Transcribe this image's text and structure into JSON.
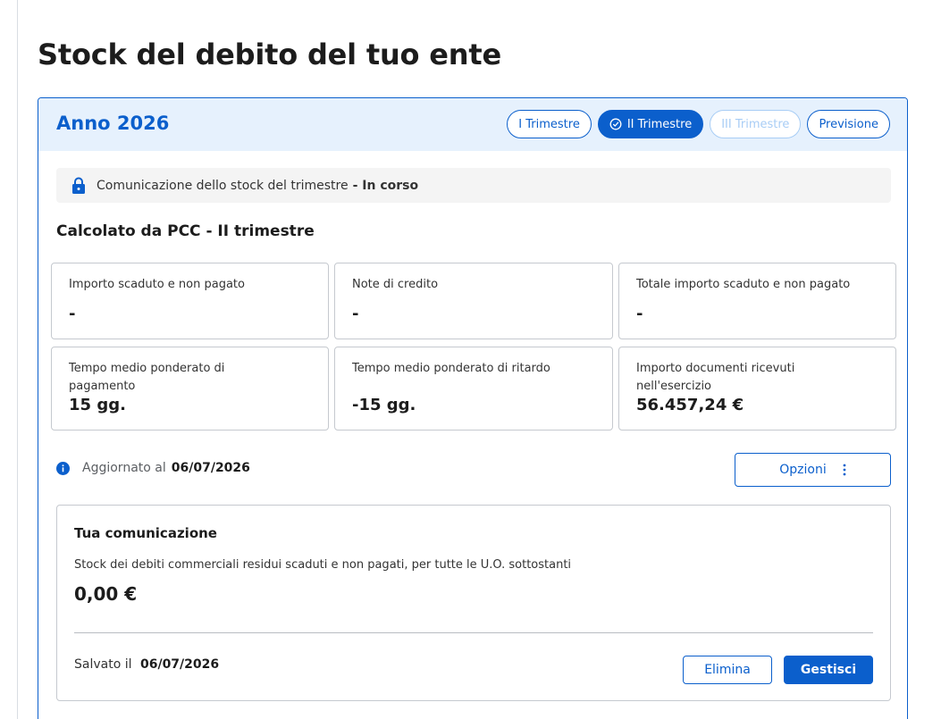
{
  "page": {
    "title": "Stock del debito del tuo ente"
  },
  "card": {
    "year": "Anno 2026",
    "tabs": [
      {
        "label": "I Trimestre",
        "state": "default"
      },
      {
        "label": "II Trimestre",
        "state": "active"
      },
      {
        "label": "III Trimestre",
        "state": "disabled"
      },
      {
        "label": "Previsione",
        "state": "default"
      }
    ],
    "alert": {
      "text": "Comunicazione dello stock del trimestre",
      "status": "- In corso",
      "icon": "lock-icon"
    },
    "section_title": "Calcolato da PCC - II trimestre",
    "tiles": [
      {
        "label": "Importo scaduto e non pagato",
        "value": "-"
      },
      {
        "label": "Note di credito",
        "value": "-"
      },
      {
        "label": "Totale importo scaduto e non pagato",
        "value": "-"
      },
      {
        "label": "Tempo medio ponderato di pagamento",
        "value": "15 gg."
      },
      {
        "label": "Tempo medio ponderato di ritardo",
        "value": "-15 gg."
      },
      {
        "label": "Importo documenti ricevuti nell'esercizio",
        "value": "56.457,24 €"
      }
    ],
    "updated": {
      "label": "Aggiornato al",
      "date": "06/07/2026"
    },
    "options_label": "Opzioni",
    "communication": {
      "title": "Tua comunicazione",
      "description": "Stock dei debiti commerciali residui scaduti e non pagati, per tutte le U.O. sottostanti",
      "value": "0,00 €",
      "saved_label": "Salvato il",
      "saved_date": "06/07/2026",
      "delete_label": "Elimina",
      "manage_label": "Gestisci"
    }
  },
  "colors": {
    "primary": "#0b5fcc",
    "header_bg": "#e6f1fd",
    "disabled": "#a8cdf5"
  }
}
